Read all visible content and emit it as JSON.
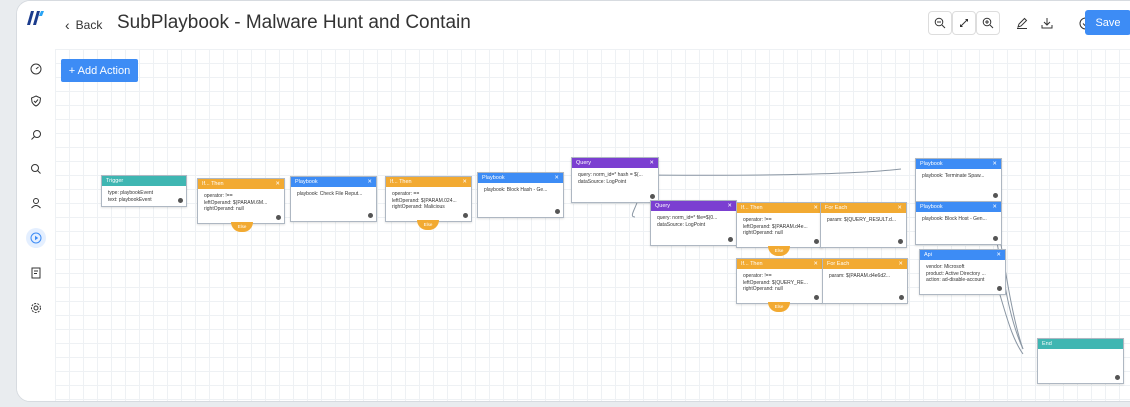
{
  "header": {
    "back_label": "Back",
    "title": "SubPlaybook - Malware Hunt and Contain",
    "save_label": "Save"
  },
  "toolbar": {
    "icons": [
      "zoom-out-icon",
      "fit-icon",
      "zoom-in-icon",
      "edit-icon",
      "download-icon",
      "check-icon"
    ]
  },
  "canvas": {
    "add_action_label": "+ Add Action"
  },
  "nodes": {
    "trigger": {
      "title": "Trigger",
      "l1": "type: playbookEvent",
      "l2": "text: playbookEvent"
    },
    "ifthen1": {
      "title": "If... Then",
      "l1": "operator: !==",
      "l2": "leftOperand: $(PARAM.6M...",
      "l3": "rightOperand: null",
      "else": "Else"
    },
    "playbook1": {
      "title": "Playbook",
      "l1": "playbook: Check File Reput..."
    },
    "ifthen2": {
      "title": "If... Then",
      "l1": "operator: ==",
      "l2": "leftOperand: $(PARAM.024...",
      "l3": "rightOperand: Malicious",
      "else": "Else"
    },
    "playbook2": {
      "title": "Playbook",
      "l1": "playbook: Block Hash - Ge..."
    },
    "query1": {
      "title": "Query",
      "l1": "query: norm_id=* hash = $(...",
      "l2": "dataSource: LogPoint"
    },
    "query2": {
      "title": "Query",
      "l1": "query: norm_id=* file=$(0...",
      "l2": "dataSource: LogPoint"
    },
    "ifthen3": {
      "title": "If... Then",
      "l1": "operator: !==",
      "l2": "leftOperand: $(PARAM.d4e...",
      "l3": "rightOperand: null",
      "else": "Else"
    },
    "foreach1": {
      "title": "For Each",
      "l1": "param: $(QUERY_RESULT.d..."
    },
    "ifthen4": {
      "title": "If... Then",
      "l1": "operator: !==",
      "l2": "leftOperand: $(QUERY_RE...",
      "l3": "rightOperand: null",
      "else": "Else"
    },
    "foreach2": {
      "title": "For Each",
      "l1": "param: $(PARAM.d4e6d2..."
    },
    "playbook3": {
      "title": "Playbook",
      "l1": "playbook: Terminate Spaw..."
    },
    "playbook4": {
      "title": "Playbook",
      "l1": "playbook: Block Host - Gen..."
    },
    "api": {
      "title": "Api",
      "l1": "vendor: Microsoft",
      "l2": "product: Active Directory ...",
      "l3": "action: ad-disable-account"
    },
    "end": {
      "title": "End"
    }
  },
  "colors": {
    "trigger": "#3fb6b2",
    "condition": "#f2aa32",
    "playbook": "#3d8cf5",
    "query": "#7b3fd1",
    "accent": "#3d8cf5"
  }
}
